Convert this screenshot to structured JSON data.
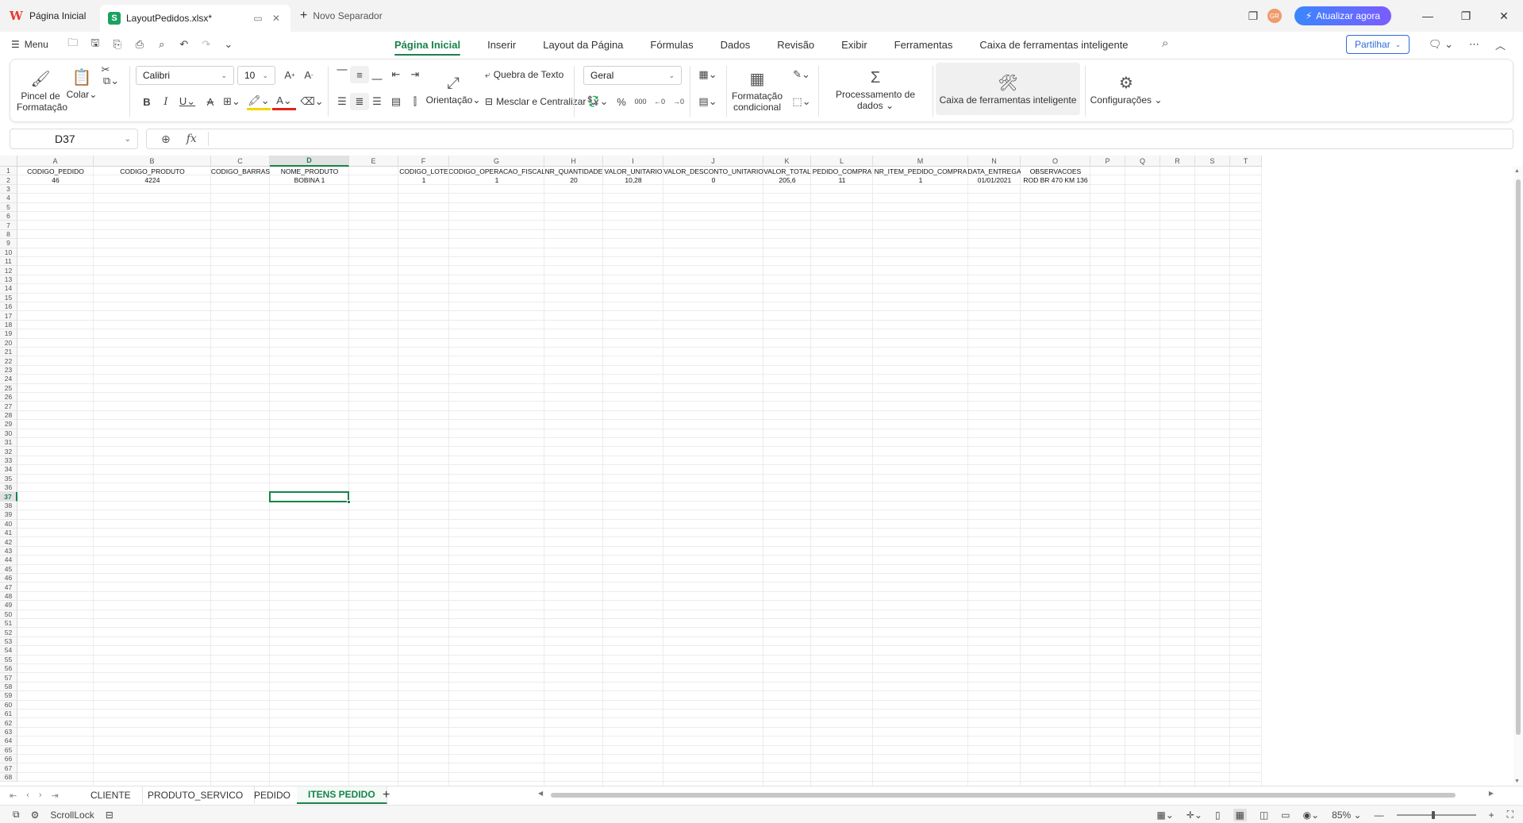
{
  "titlebar": {
    "home_tab": "Página Inicial",
    "file_tab": "LayoutPedidos.xlsx*",
    "new_tab": "Novo Separador",
    "avatar_initials": "GR",
    "upgrade_label": "Atualizar agora"
  },
  "menu": {
    "menu_label": "Menu",
    "tabs": [
      "Página Inicial",
      "Inserir",
      "Layout da Página",
      "Fórmulas",
      "Dados",
      "Revisão",
      "Exibir",
      "Ferramentas",
      "Caixa de ferramentas inteligente"
    ],
    "share_label": "Partilhar"
  },
  "ribbon": {
    "format_painter": "Pincel de Formatação",
    "paste": "Colar",
    "font_name": "Calibri",
    "font_size": "10",
    "wrap_text": "Quebra de Texto",
    "orientation": "Orientação",
    "merge_center": "Mesclar e Centralizar",
    "number_format": "Geral",
    "conditional_format": "Formatação condicional",
    "data_processing": "Processamento de dados",
    "smart_toolbox": "Caixa de ferramentas inteligente",
    "settings": "Configurações"
  },
  "formula_bar": {
    "name_box": "D37",
    "fx_symbol": "fx",
    "formula": ""
  },
  "grid": {
    "columns": [
      "A",
      "B",
      "C",
      "D",
      "E",
      "F",
      "G",
      "H",
      "I",
      "J",
      "K",
      "L",
      "M",
      "N",
      "O",
      "P",
      "Q",
      "R",
      "S",
      "T"
    ],
    "selected_column": "D",
    "selected_row": "37",
    "header_row": [
      "CODIGO_PEDIDO",
      "CODIGO_PRODUTO",
      "CODIGO_BARRAS",
      "NOME_PRODUTO",
      "",
      "CODIGO_LOTE",
      "CODIGO_OPERACAO_FISCAL",
      "NR_QUANTIDADE",
      "VALOR_UNITARIO",
      "VALOR_DESCONTO_UNITARIO",
      "VALOR_TOTAL",
      "PEDIDO_COMPRA",
      "NR_ITEM_PEDIDO_COMPRA",
      "DATA_ENTREGA",
      "OBSERVACOES"
    ],
    "data_row": [
      "46",
      "4224",
      "",
      "BOBINA 1",
      "",
      "1",
      "1",
      "20",
      "10,28",
      "0",
      "205,6",
      "11",
      "1",
      "01/01/2021",
      "ROD BR 470 KM 136"
    ]
  },
  "sheets": {
    "tabs": [
      "CLIENTE",
      "PRODUTO_SERVICO",
      "PEDIDO",
      "ITENS PEDIDO"
    ],
    "active": "ITENS PEDIDO"
  },
  "status": {
    "scroll_lock": "ScrollLock",
    "zoom": "85%"
  },
  "colors": {
    "accent": "#18824a",
    "share": "#2f6bd8",
    "font_color": "#e2231a",
    "highlight": "#f2d600"
  }
}
